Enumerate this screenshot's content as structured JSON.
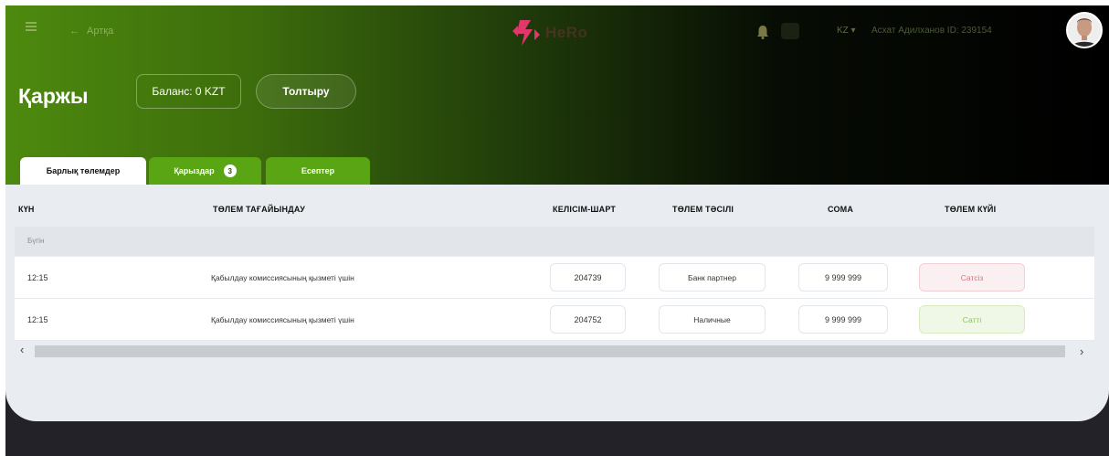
{
  "colors": {
    "hero_start": "#4d8a0e",
    "hero_end": "#000000",
    "tab_active_bg": "#ffffff",
    "tab_inactive_bg": "#5aa514",
    "status_pending": "#d67380",
    "status_paid": "#94c06a"
  },
  "header": {
    "menu_icon": "hamburger-icon",
    "back_label": "Артқа",
    "brand": "HeRo",
    "language": "KZ",
    "user": "Асхат Адилханов ID: 239154"
  },
  "page": {
    "title": "Қаржы",
    "balance_label": "Баланс: 0 KZT",
    "topup_label": "Толтыру"
  },
  "tabs": [
    {
      "label": "Барлық төлемдер",
      "active": true
    },
    {
      "label": "Қарыздар",
      "badge": "3",
      "active": false
    },
    {
      "label": "Есептер",
      "active": false
    }
  ],
  "table": {
    "columns": [
      "КҮН",
      "ТӨЛЕМ ТАҒАЙЫНДАУ",
      "КЕЛІСІМ-ШАРТ",
      "ТӨЛЕМ ТӘСІЛІ",
      "СОМА",
      "ТӨЛЕМ КҮЙІ"
    ],
    "group_label": "Бүгін",
    "rows": [
      {
        "time": "12:15",
        "purpose": "Қабылдау комиссиясының қызметі үшін",
        "contract": "204739",
        "method": "Банк партнер",
        "amount": "9 999 999",
        "status": "Сатсіз",
        "status_type": "pending"
      },
      {
        "time": "12:15",
        "purpose": "Қабылдау комиссиясының қызметі үшін",
        "contract": "204752",
        "method": "Наличные",
        "amount": "9 999 999",
        "status": "Сатті",
        "status_type": "paid"
      }
    ]
  }
}
